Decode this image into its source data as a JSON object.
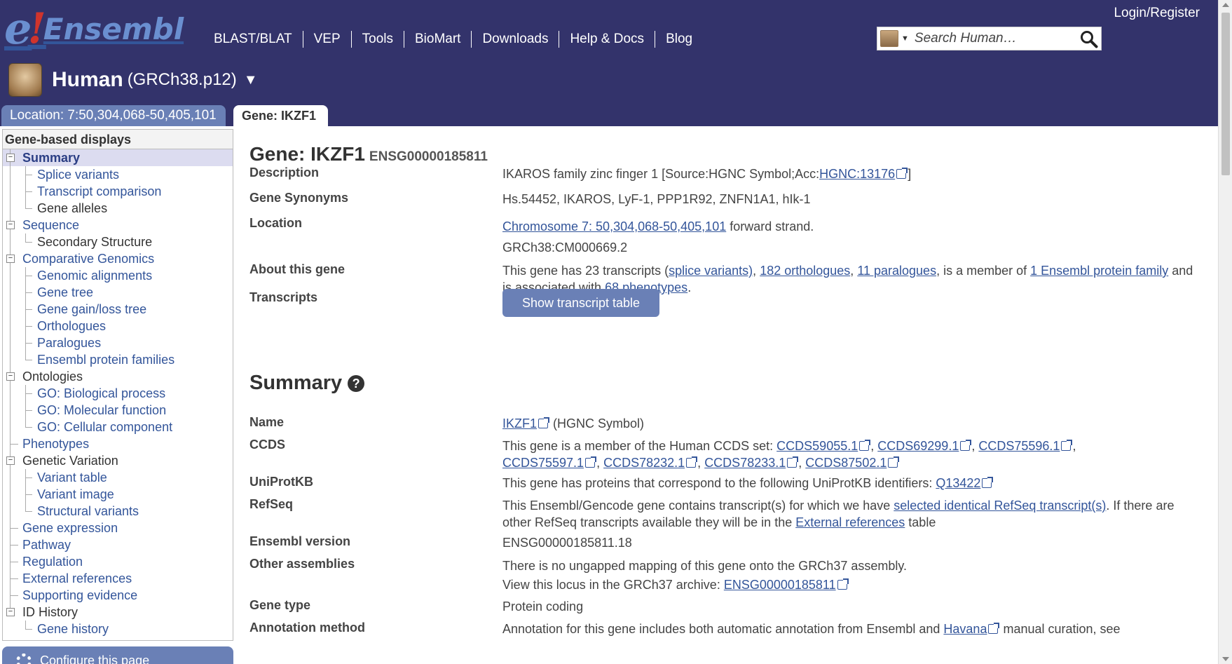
{
  "header": {
    "logo_e": "e",
    "logo_bang": "!",
    "logo_text": "Ensembl",
    "nav": [
      "BLAST/BLAT",
      "VEP",
      "Tools",
      "BioMart",
      "Downloads",
      "Help & Docs",
      "Blog"
    ],
    "login": "Login/Register",
    "search_placeholder": "Search Human…"
  },
  "species": {
    "name": "Human",
    "assembly": "(GRCh38.p12)",
    "caret": "▼"
  },
  "tabs": {
    "location": "Location: 7:50,304,068-50,405,101",
    "gene": "Gene: IKZF1"
  },
  "sidebar": {
    "header": "Gene-based displays",
    "items": [
      {
        "label": "Summary",
        "level": 0,
        "toggle": "−",
        "link": true,
        "selected": true
      },
      {
        "label": "Splice variants",
        "level": 1,
        "link": true
      },
      {
        "label": "Transcript comparison",
        "level": 1,
        "link": true
      },
      {
        "label": "Gene alleles",
        "level": 1,
        "link": false
      },
      {
        "label": "Sequence",
        "level": 0,
        "toggle": "−",
        "link": true
      },
      {
        "label": "Secondary Structure",
        "level": 1,
        "link": false
      },
      {
        "label": "Comparative Genomics",
        "level": 0,
        "toggle": "−",
        "link": true
      },
      {
        "label": "Genomic alignments",
        "level": 1,
        "link": true
      },
      {
        "label": "Gene tree",
        "level": 1,
        "link": true
      },
      {
        "label": "Gene gain/loss tree",
        "level": 1,
        "link": true
      },
      {
        "label": "Orthologues",
        "level": 1,
        "link": true
      },
      {
        "label": "Paralogues",
        "level": 1,
        "link": true
      },
      {
        "label": "Ensembl protein families",
        "level": 1,
        "link": true
      },
      {
        "label": "Ontologies",
        "level": 0,
        "toggle": "−",
        "link": false
      },
      {
        "label": "GO: Biological process",
        "level": 1,
        "link": true
      },
      {
        "label": "GO: Molecular function",
        "level": 1,
        "link": true
      },
      {
        "label": "GO: Cellular component",
        "level": 1,
        "link": true
      },
      {
        "label": "Phenotypes",
        "level": 0,
        "link": true
      },
      {
        "label": "Genetic Variation",
        "level": 0,
        "toggle": "−",
        "link": false
      },
      {
        "label": "Variant table",
        "level": 1,
        "link": true
      },
      {
        "label": "Variant image",
        "level": 1,
        "link": true
      },
      {
        "label": "Structural variants",
        "level": 1,
        "link": true
      },
      {
        "label": "Gene expression",
        "level": 0,
        "link": true
      },
      {
        "label": "Pathway",
        "level": 0,
        "link": true
      },
      {
        "label": "Regulation",
        "level": 0,
        "link": true
      },
      {
        "label": "External references",
        "level": 0,
        "link": true
      },
      {
        "label": "Supporting evidence",
        "level": 0,
        "link": true
      },
      {
        "label": "ID History",
        "level": 0,
        "toggle": "−",
        "link": false
      },
      {
        "label": "Gene history",
        "level": 1,
        "link": true
      }
    ],
    "configure": "Configure this page"
  },
  "main": {
    "title": "Gene: IKZF1",
    "stable_id": "ENSG00000185811",
    "description_label": "Description",
    "description_text": "IKAROS family zinc finger 1 [Source:HGNC Symbol;Acc:",
    "description_link": "HGNC:13176",
    "description_end": "]",
    "synonyms_label": "Gene Synonyms",
    "synonyms": "Hs.54452, IKAROS, LyF-1, PPP1R92, ZNFN1A1, hIk-1",
    "location_label": "Location",
    "location_link": "Chromosome 7: 50,304,068-50,405,101",
    "location_strand": " forward strand.",
    "location_assembly": "GRCh38:CM000669.2",
    "about_label": "About this gene",
    "about_1": "This gene has 23 transcripts (",
    "about_splice": "splice variants)",
    "about_2": ", ",
    "about_ortho": "182 orthologues",
    "about_3": ", ",
    "about_para": "11 paralogues",
    "about_4": ", is a member of ",
    "about_family": "1 Ensembl protein family",
    "about_5": " and is associated with ",
    "about_pheno": "68 phenotypes",
    "about_6": ".",
    "transcripts_label": "Transcripts",
    "transcripts_button": "Show transcript table",
    "summary_title": "Summary",
    "summary_help": "?",
    "name_label": "Name",
    "name_link": "IKZF1",
    "name_source": " (HGNC Symbol)",
    "ccds_label": "CCDS",
    "ccds_intro": "This gene is a member of the Human CCDS set: ",
    "ccds": [
      "CCDS59055.1",
      "CCDS69299.1",
      "CCDS75596.1",
      "CCDS75597.1",
      "CCDS78232.1",
      "CCDS78233.1",
      "CCDS87502.1"
    ],
    "uniprot_label": "UniProtKB",
    "uniprot_text": "This gene has proteins that correspond to the following UniProtKB identifiers: ",
    "uniprot_link": "Q13422",
    "refseq_label": "RefSeq",
    "refseq_1": "This Ensembl/Gencode gene contains transcript(s) for which we have ",
    "refseq_link": "selected identical RefSeq transcript(s)",
    "refseq_2": ". If there are other RefSeq transcripts available they will be in the ",
    "refseq_link2": "External references",
    "refseq_3": " table",
    "version_label": "Ensembl version",
    "version": "ENSG00000185811.18",
    "other_label": "Other assemblies",
    "other_1": "There is no ungapped mapping of this gene onto the GRCh37 assembly.",
    "other_2": "View this locus in the GRCh37 archive: ",
    "other_link": "ENSG00000185811",
    "type_label": "Gene type",
    "type": "Protein coding",
    "annotation_label": "Annotation method",
    "annotation_1": "Annotation for this gene includes both automatic annotation from Ensembl and ",
    "annotation_link": "Havana",
    "annotation_2": " manual curation, see"
  },
  "colors": {
    "header_bg": "#33336b",
    "tab_bg": "#6a80b6",
    "link": "#33559a",
    "selected_bg": "#dcdcf0"
  }
}
